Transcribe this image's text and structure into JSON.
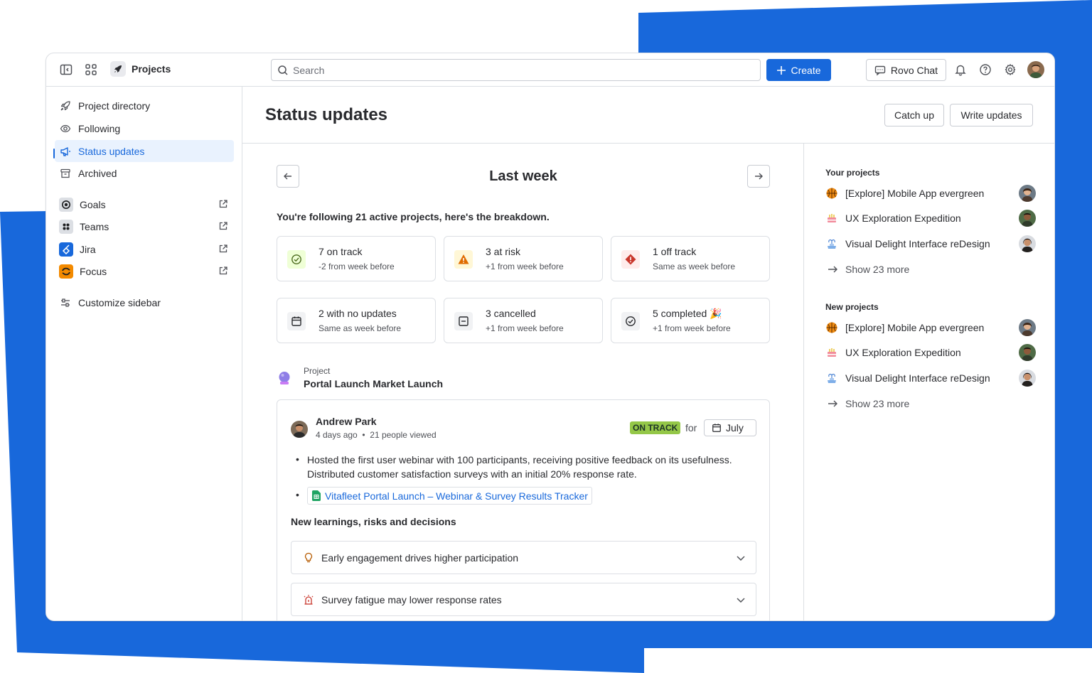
{
  "colors": {
    "brand": "#1868db",
    "on_track": "#94c748",
    "at_risk": "#e2b203",
    "off_track": "#c9372c",
    "background_shape": "#1868db"
  },
  "topbar": {
    "app_name": "Projects",
    "search_placeholder": "Search",
    "create_label": "Create",
    "rovo_label": "Rovo Chat",
    "icons": [
      "sidebar-toggle-icon",
      "app-switcher-icon",
      "bell-icon",
      "help-icon",
      "gear-icon"
    ]
  },
  "sidebar": {
    "items": [
      {
        "label": "Project directory",
        "icon": "rocket-icon"
      },
      {
        "label": "Following",
        "icon": "eye-icon"
      },
      {
        "label": "Status updates",
        "icon": "megaphone-icon",
        "active": true
      },
      {
        "label": "Archived",
        "icon": "archive-icon"
      }
    ],
    "apps": [
      {
        "label": "Goals",
        "icon": "goals-icon"
      },
      {
        "label": "Teams",
        "icon": "teams-icon"
      },
      {
        "label": "Jira",
        "icon": "jira-icon"
      },
      {
        "label": "Focus",
        "icon": "focus-icon"
      }
    ],
    "customize_label": "Customize sidebar"
  },
  "header": {
    "title": "Status updates",
    "catch_up_label": "Catch up",
    "write_updates_label": "Write updates"
  },
  "main": {
    "period_label": "Last week",
    "breakdown_text": "You're following 21 active projects, here's the breakdown.",
    "stats": [
      {
        "title": "7 on track",
        "sub": "-2 from week before",
        "icon": "check-circle-icon"
      },
      {
        "title": "3 at risk",
        "sub": "+1 from week before",
        "icon": "warning-icon"
      },
      {
        "title": "1 off track",
        "sub": "Same as week before",
        "icon": "error-icon"
      },
      {
        "title": "2 with no updates",
        "sub": "Same as week before",
        "icon": "calendar-icon"
      },
      {
        "title": "3 cancelled",
        "sub": "+1 from week before",
        "icon": "cancelled-icon"
      },
      {
        "title": "5 completed 🎉",
        "sub": "+1 from week before",
        "icon": "completed-icon"
      }
    ],
    "project": {
      "kicker": "Project",
      "name": "Portal Launch Market Launch"
    },
    "update": {
      "author": "Andrew Park",
      "time": "4 days ago",
      "views": "21 people viewed",
      "status": "ON TRACK",
      "for_label": "for",
      "month": "July",
      "bullet_text": "Hosted the first user webinar with 100 participants, receiving positive feedback on its usefulness. Distributed customer satisfaction surveys with an initial 20% response rate.",
      "link_text": "Vitafleet Portal Launch – Webinar & Survey Results Tracker",
      "learnings_title": "New learnings, risks and decisions",
      "learnings": [
        {
          "label": "Early engagement drives higher participation",
          "icon": "lightbulb-icon"
        },
        {
          "label": "Survey fatigue may lower response rates",
          "icon": "siren-icon"
        }
      ]
    }
  },
  "right_panel": {
    "your_projects_title": "Your projects",
    "your_projects": [
      {
        "name": "[Explore] Mobile App evergreen",
        "icon": "basketball-icon"
      },
      {
        "name": "UX Exploration Expedition",
        "icon": "cake-icon"
      },
      {
        "name": "Visual Delight Interface reDesign",
        "icon": "fountain-icon"
      }
    ],
    "your_more": "Show 23 more",
    "new_projects_title": "New projects",
    "new_projects": [
      {
        "name": "[Explore] Mobile App evergreen",
        "icon": "basketball-icon"
      },
      {
        "name": "UX Exploration Expedition",
        "icon": "cake-icon"
      },
      {
        "name": "Visual Delight Interface reDesign",
        "icon": "fountain-icon"
      }
    ],
    "new_more": "Show 23 more"
  }
}
